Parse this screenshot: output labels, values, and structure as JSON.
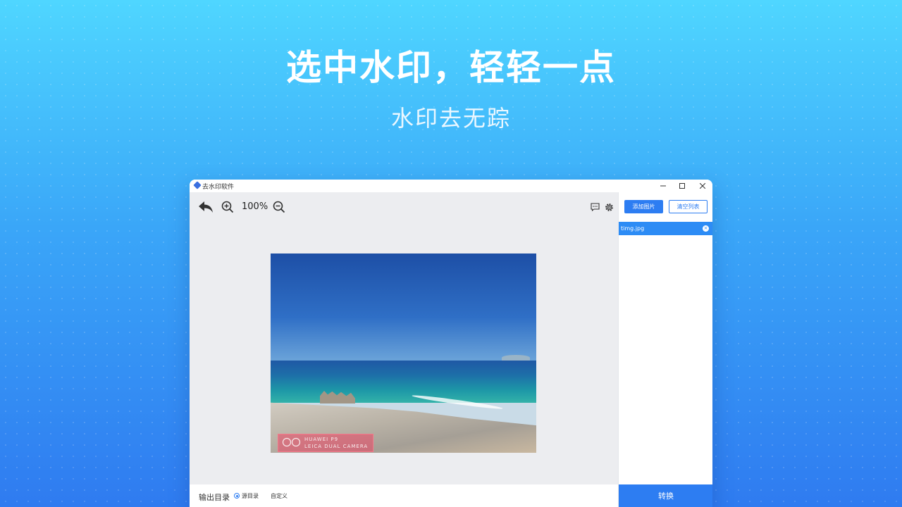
{
  "hero": {
    "headline": "选中水印，轻轻一点",
    "subline": "水印去无踪"
  },
  "window": {
    "title": "去水印软件",
    "app_icon": "diamond-logo-icon",
    "controls": [
      "minimize-icon",
      "maximize-icon",
      "close-icon"
    ]
  },
  "toolbar": {
    "undo_icon": "undo-arrow-icon",
    "zoom_in_icon": "zoom-in-icon",
    "zoom_level": "100%",
    "zoom_out_icon": "zoom-out-icon",
    "comment_icon": "comment-icon",
    "settings_icon": "gear-icon"
  },
  "image": {
    "watermark_line1": "HUAWEI P9",
    "watermark_line2": "LEICA DUAL CAMERA"
  },
  "output": {
    "label": "输出目录",
    "options": [
      {
        "label": "源目录",
        "selected": true
      },
      {
        "label": "自定义",
        "selected": false
      }
    ]
  },
  "sidebar": {
    "add_button": "添加图片",
    "clear_button": "清空列表",
    "files": [
      {
        "name": "timg.jpg",
        "selected": true
      }
    ],
    "convert_button": "转换"
  },
  "colors": {
    "accent": "#2d7df2",
    "background_top": "#4fd6ff",
    "background_bottom": "#2f7bf0"
  }
}
